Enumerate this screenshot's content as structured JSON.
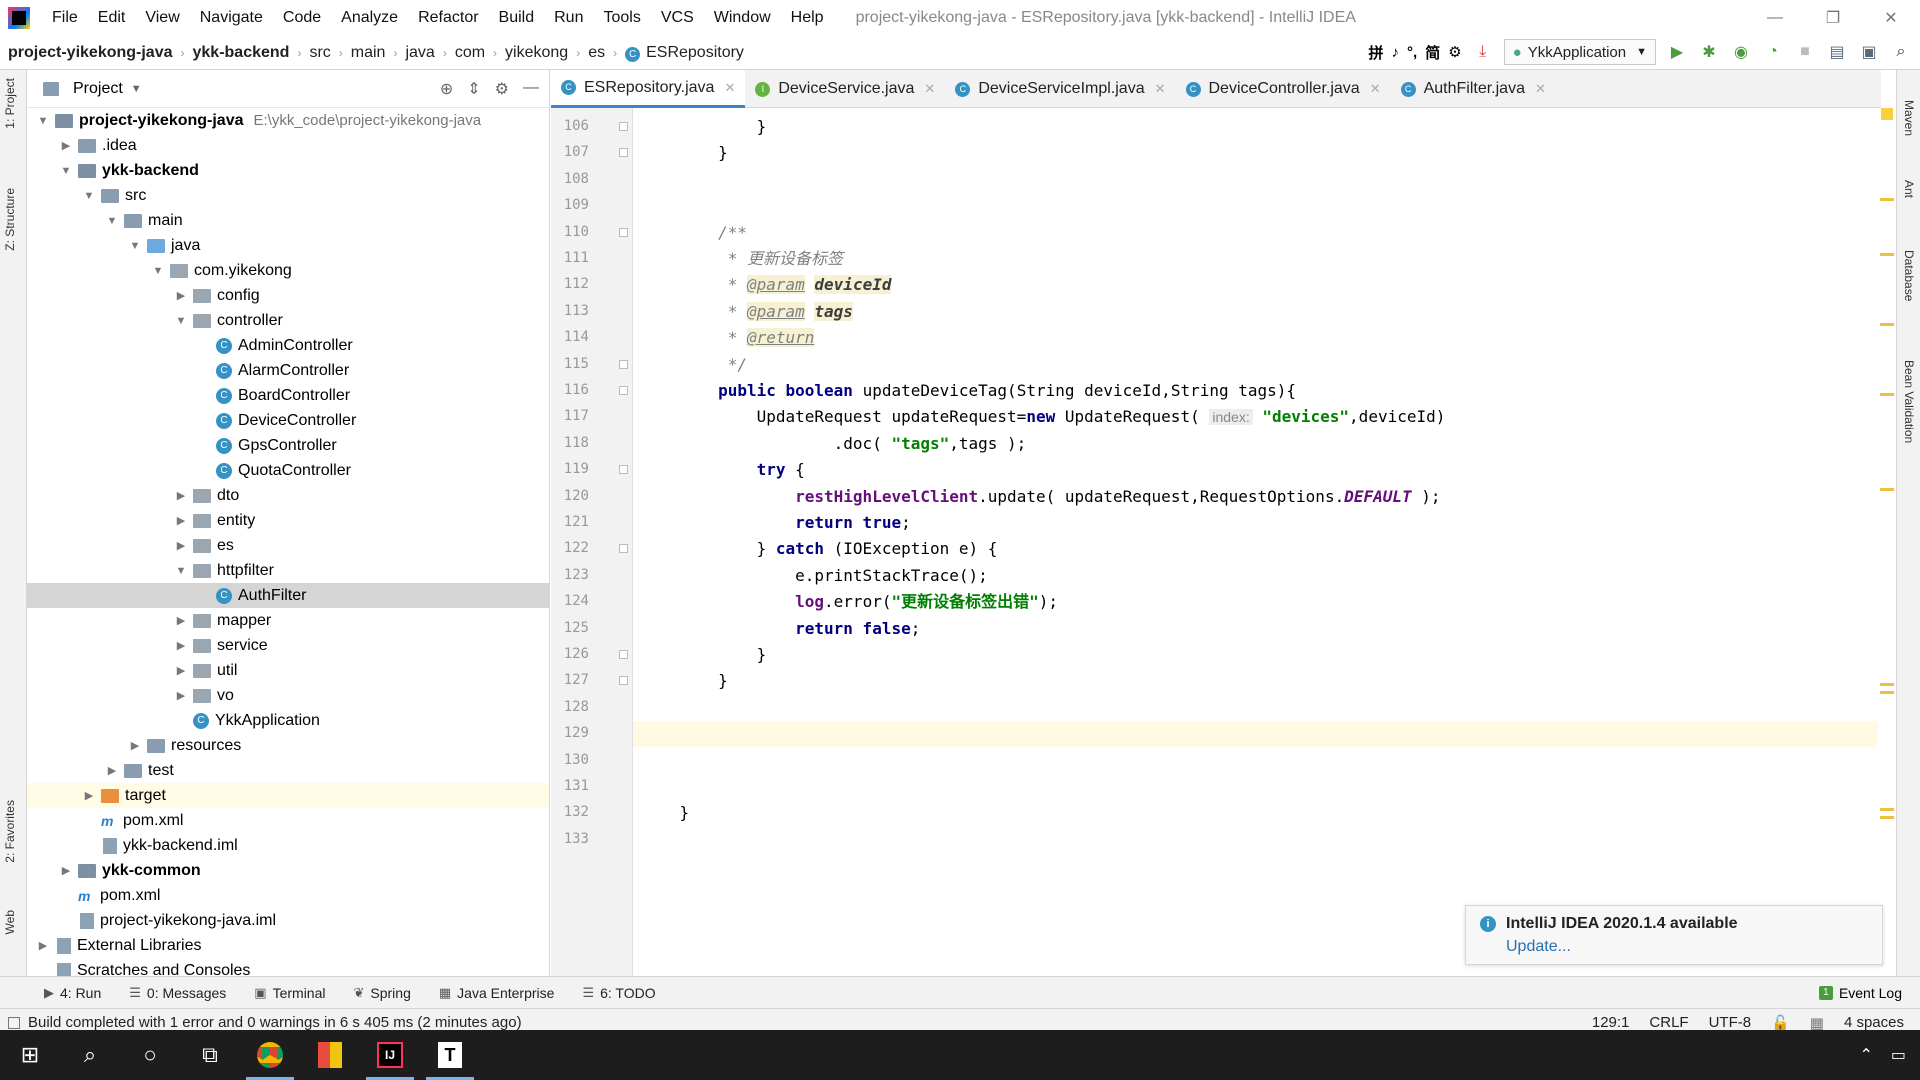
{
  "window": {
    "title": "project-yikekong-java - ESRepository.java [ykk-backend] - IntelliJ IDEA",
    "menu": [
      "File",
      "Edit",
      "View",
      "Navigate",
      "Code",
      "Analyze",
      "Refactor",
      "Build",
      "Run",
      "Tools",
      "VCS",
      "Window",
      "Help"
    ],
    "controls": {
      "minimize": "—",
      "restore": "❐",
      "close": "✕"
    }
  },
  "navbar": {
    "breadcrumbs": [
      "project-yikekong-java",
      "ykk-backend",
      "src",
      "main",
      "java",
      "com",
      "yikekong",
      "es",
      "ESRepository"
    ],
    "run_config": "YkkApplication",
    "ime_icons": [
      "拼",
      "♪",
      "°,",
      "简",
      "⚙"
    ]
  },
  "left_strip": {
    "tabs": [
      "1: Project",
      "Z: Structure",
      "2: Favorites",
      "Web"
    ]
  },
  "project_panel": {
    "title": "Project",
    "tree": [
      {
        "label": "project-yikekong-java",
        "path": "E:\\ykk_code\\project-yikekong-java",
        "depth": 0,
        "icon": "module",
        "expanded": true,
        "bold": true
      },
      {
        "label": ".idea",
        "depth": 1,
        "icon": "folder",
        "expanded": false
      },
      {
        "label": "ykk-backend",
        "depth": 1,
        "icon": "module",
        "expanded": true,
        "bold": true
      },
      {
        "label": "src",
        "depth": 2,
        "icon": "folder",
        "expanded": true
      },
      {
        "label": "main",
        "depth": 3,
        "icon": "folder",
        "expanded": true
      },
      {
        "label": "java",
        "depth": 4,
        "icon": "src",
        "expanded": true
      },
      {
        "label": "com.yikekong",
        "depth": 5,
        "icon": "package",
        "expanded": true
      },
      {
        "label": "config",
        "depth": 6,
        "icon": "package",
        "expanded": false
      },
      {
        "label": "controller",
        "depth": 6,
        "icon": "package",
        "expanded": true
      },
      {
        "label": "AdminController",
        "depth": 7,
        "icon": "class"
      },
      {
        "label": "AlarmController",
        "depth": 7,
        "icon": "class"
      },
      {
        "label": "BoardController",
        "depth": 7,
        "icon": "class"
      },
      {
        "label": "DeviceController",
        "depth": 7,
        "icon": "class"
      },
      {
        "label": "GpsController",
        "depth": 7,
        "icon": "class"
      },
      {
        "label": "QuotaController",
        "depth": 7,
        "icon": "class"
      },
      {
        "label": "dto",
        "depth": 6,
        "icon": "package",
        "expanded": false
      },
      {
        "label": "entity",
        "depth": 6,
        "icon": "package",
        "expanded": false
      },
      {
        "label": "es",
        "depth": 6,
        "icon": "package",
        "expanded": false
      },
      {
        "label": "httpfilter",
        "depth": 6,
        "icon": "package",
        "expanded": true
      },
      {
        "label": "AuthFilter",
        "depth": 7,
        "icon": "class",
        "selected": true
      },
      {
        "label": "mapper",
        "depth": 6,
        "icon": "package",
        "expanded": false
      },
      {
        "label": "service",
        "depth": 6,
        "icon": "package",
        "expanded": false
      },
      {
        "label": "util",
        "depth": 6,
        "icon": "package",
        "expanded": false
      },
      {
        "label": "vo",
        "depth": 6,
        "icon": "package",
        "expanded": false
      },
      {
        "label": "YkkApplication",
        "depth": 6,
        "icon": "class"
      },
      {
        "label": "resources",
        "depth": 4,
        "icon": "folder",
        "expanded": false
      },
      {
        "label": "test",
        "depth": 3,
        "icon": "folder",
        "expanded": false
      },
      {
        "label": "target",
        "depth": 2,
        "icon": "orange-folder",
        "expanded": false,
        "highlight": true
      },
      {
        "label": "pom.xml",
        "depth": 2,
        "icon": "maven"
      },
      {
        "label": "ykk-backend.iml",
        "depth": 2,
        "icon": "file"
      },
      {
        "label": "ykk-common",
        "depth": 1,
        "icon": "module",
        "expanded": false,
        "bold": true
      },
      {
        "label": "pom.xml",
        "depth": 1,
        "icon": "maven"
      },
      {
        "label": "project-yikekong-java.iml",
        "depth": 1,
        "icon": "file"
      },
      {
        "label": "External Libraries",
        "depth": 0,
        "icon": "library",
        "expanded": false
      },
      {
        "label": "Scratches and Consoles",
        "depth": 0,
        "icon": "scratch"
      }
    ]
  },
  "editor": {
    "tabs": [
      {
        "label": "ESRepository.java",
        "icon": "C",
        "active": true
      },
      {
        "label": "DeviceService.java",
        "icon": "I",
        "active": false
      },
      {
        "label": "DeviceServiceImpl.java",
        "icon": "C",
        "active": false
      },
      {
        "label": "DeviceController.java",
        "icon": "C",
        "active": false
      },
      {
        "label": "AuthFilter.java",
        "icon": "C",
        "active": false
      }
    ],
    "first_line": 106,
    "current_line": 129,
    "lines": [
      [
        {
          "t": "            }"
        }
      ],
      [
        {
          "t": "        }"
        }
      ],
      [
        {
          "t": ""
        }
      ],
      [
        {
          "t": ""
        }
      ],
      [
        {
          "t": "        /**",
          "c": "cm"
        }
      ],
      [
        {
          "t": "         * 更新设备标签",
          "c": "cm"
        }
      ],
      [
        {
          "t": "         * ",
          "c": "cm"
        },
        {
          "t": "@param",
          "c": "tagk"
        },
        {
          "t": " ",
          "c": "cm"
        },
        {
          "t": "deviceId",
          "c": "tagv"
        }
      ],
      [
        {
          "t": "         * ",
          "c": "cm"
        },
        {
          "t": "@param",
          "c": "tagk"
        },
        {
          "t": " ",
          "c": "cm"
        },
        {
          "t": "tags",
          "c": "tagv"
        }
      ],
      [
        {
          "t": "         * ",
          "c": "cm"
        },
        {
          "t": "@return",
          "c": "tagk"
        }
      ],
      [
        {
          "t": "         */",
          "c": "cm"
        }
      ],
      [
        {
          "t": "        "
        },
        {
          "t": "public boolean ",
          "c": "kw"
        },
        {
          "t": "updateDeviceTag(String deviceId,String tags){"
        }
      ],
      [
        {
          "t": "            UpdateRequest updateRequest="
        },
        {
          "t": "new ",
          "c": "kw"
        },
        {
          "t": "UpdateRequest( "
        },
        {
          "t": "index:",
          "c": "hint"
        },
        {
          "t": " "
        },
        {
          "t": "\"devices\"",
          "c": "str"
        },
        {
          "t": ",deviceId)"
        }
      ],
      [
        {
          "t": "                    .doc( "
        },
        {
          "t": "\"tags\"",
          "c": "str"
        },
        {
          "t": ",tags );"
        }
      ],
      [
        {
          "t": "            "
        },
        {
          "t": "try ",
          "c": "kw"
        },
        {
          "t": "{"
        }
      ],
      [
        {
          "t": "                "
        },
        {
          "t": "restHighLevelClient",
          "c": "fld"
        },
        {
          "t": ".update( updateRequest,RequestOptions."
        },
        {
          "t": "DEFAULT",
          "c": "stat"
        },
        {
          "t": " );"
        }
      ],
      [
        {
          "t": "                "
        },
        {
          "t": "return true",
          "c": "kw"
        },
        {
          "t": ";"
        }
      ],
      [
        {
          "t": "            } "
        },
        {
          "t": "catch ",
          "c": "kw"
        },
        {
          "t": "(IOException e) {"
        }
      ],
      [
        {
          "t": "                e.printStackTrace();"
        }
      ],
      [
        {
          "t": "                "
        },
        {
          "t": "log",
          "c": "fld"
        },
        {
          "t": ".error("
        },
        {
          "t": "\"更新设备标签出错\"",
          "c": "str"
        },
        {
          "t": ");"
        }
      ],
      [
        {
          "t": "                "
        },
        {
          "t": "return false",
          "c": "kw"
        },
        {
          "t": ";"
        }
      ],
      [
        {
          "t": "            }"
        }
      ],
      [
        {
          "t": "        }"
        }
      ],
      [
        {
          "t": ""
        }
      ],
      [
        {
          "t": ""
        }
      ],
      [
        {
          "t": ""
        }
      ],
      [
        {
          "t": ""
        }
      ],
      [
        {
          "t": "    }"
        }
      ],
      [
        {
          "t": ""
        }
      ]
    ]
  },
  "right_strip": {
    "tabs": [
      "Maven",
      "Ant",
      "Database",
      "Bean Validation"
    ]
  },
  "notification": {
    "title": "IntelliJ IDEA 2020.1.4 available",
    "action": "Update..."
  },
  "tool_windows": [
    {
      "label": "4: Run",
      "icon": "▶"
    },
    {
      "label": "0: Messages",
      "icon": "☰"
    },
    {
      "label": "Terminal",
      "icon": "▣"
    },
    {
      "label": "Spring",
      "icon": "❦"
    },
    {
      "label": "Java Enterprise",
      "icon": "▦"
    },
    {
      "label": "6: TODO",
      "icon": "☰"
    }
  ],
  "event_log": "Event Log",
  "status": {
    "message": "Build completed with 1 error and 0 warnings in 6 s 405 ms (2 minutes ago)",
    "position": "129:1",
    "line_sep": "CRLF",
    "encoding": "UTF-8",
    "indent": "4 spaces"
  },
  "taskbar": {
    "items": [
      "start",
      "search",
      "cortana",
      "task-view",
      "chrome",
      "office",
      "intellij",
      "typora"
    ]
  }
}
